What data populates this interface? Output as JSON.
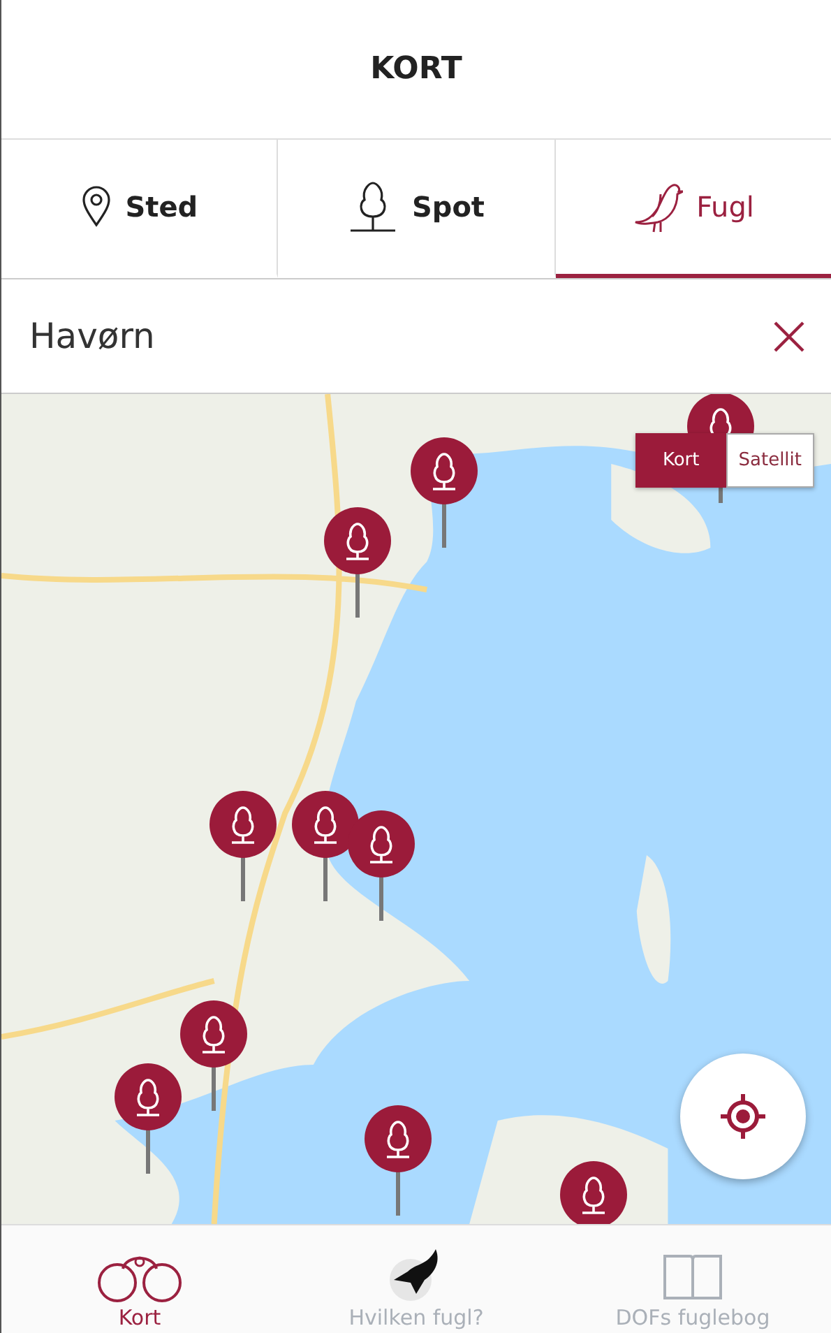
{
  "header": {
    "title": "KORT"
  },
  "tabs": [
    {
      "label": "Sted",
      "kind": "place",
      "selected": false
    },
    {
      "label": "Spot",
      "kind": "spot",
      "selected": false
    },
    {
      "label": "Fugl",
      "kind": "bird",
      "selected": true
    }
  ],
  "search": {
    "value": "Havørn"
  },
  "map": {
    "type_toggle": [
      {
        "label": "Kort",
        "selected": true
      },
      {
        "label": "Satellit",
        "selected": false
      }
    ]
  },
  "bottom_nav": [
    {
      "label": "Kort",
      "kind": "map",
      "selected": true
    },
    {
      "label": "Hvilken fugl?",
      "kind": "identify",
      "selected": false
    },
    {
      "label": "DOFs fuglebog",
      "kind": "book",
      "selected": false
    }
  ]
}
